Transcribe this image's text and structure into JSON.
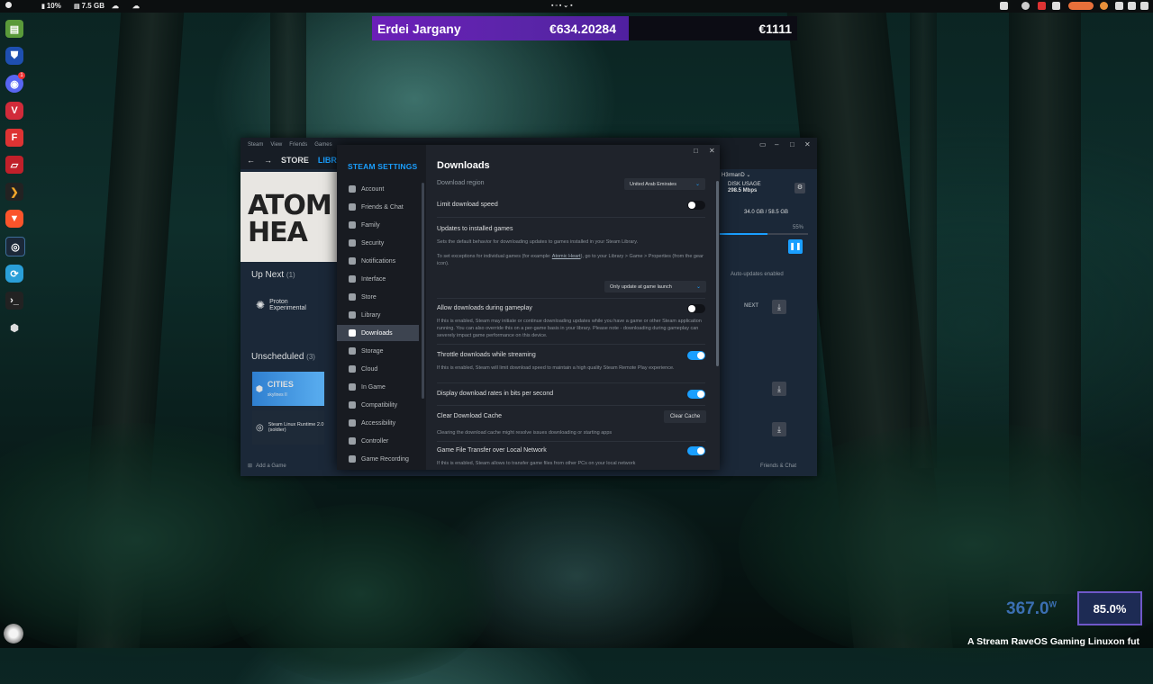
{
  "topbar": {
    "battery": "10%",
    "memory": "7.5 GB"
  },
  "banner": {
    "name": "Erdei Jargany",
    "amount": "€634.20284",
    "total": "€1111"
  },
  "dock": {
    "discord_badge": "1"
  },
  "library": {
    "menu": [
      "Steam",
      "View",
      "Friends",
      "Games"
    ],
    "nav": {
      "store": "STORE",
      "library": "LIBRARY"
    },
    "hero_lines": [
      "ATOM",
      "HEA"
    ],
    "up_next": {
      "title": "Up Next",
      "count": "(1)",
      "item": "Proton Experimental"
    },
    "unscheduled": {
      "title": "Unscheduled",
      "count": "(3)",
      "item1": "CITIES",
      "item1_sub": "skylines II",
      "item2": "Steam Linux Runtime 2.0 (soldier)"
    },
    "add_game": "Add a Game",
    "user": "H3rmanD",
    "disk_usage_label": "DISK USAGE",
    "disk_rate": "298.5 Mbps",
    "disk_size": "34.0 GB / 58.5 GB",
    "progress": "55%",
    "auto_updates": "Auto-updates enabled",
    "next": "NEXT",
    "friends_chat": "Friends & Chat"
  },
  "settings": {
    "title": "STEAM SETTINGS",
    "nav": [
      "Account",
      "Friends & Chat",
      "Family",
      "Security",
      "Notifications",
      "Interface",
      "Store",
      "Library",
      "Downloads",
      "Storage",
      "Cloud",
      "In Game",
      "Compatibility",
      "Accessibility",
      "Controller",
      "Game Recording"
    ],
    "heading": "Downloads",
    "download_region_label": "Download region",
    "download_region_value": "United Arab Emirates",
    "limit_speed": "Limit download speed",
    "updates_title": "Updates to installed games",
    "updates_desc": "Sets the default behavior for downloading updates to games installed in your Steam Library.",
    "updates_desc2_a": "To set exceptions for individual games (for example: ",
    "updates_desc2_link": "Atomic Heart",
    "updates_desc2_b": "), go to your Library > Game > Properties (from the gear icon).",
    "updates_value": "Only update at game launch",
    "allow_gameplay": "Allow downloads during gameplay",
    "allow_gameplay_desc": "If this is enabled, Steam may initiate or continue downloading updates while you have a game or other Steam application running. You can also override this on a per-game basis in your library. Please note - downloading during gameplay can severely impact game performance on this device.",
    "throttle": "Throttle downloads while streaming",
    "throttle_desc": "If this is enabled, Steam will limit download speed to maintain a high quality Steam Remote Play experience.",
    "bits": "Display download rates in bits per second",
    "clear_cache": "Clear Download Cache",
    "clear_cache_btn": "Clear Cache",
    "clear_cache_desc": "Clearing the download cache might resolve issues downloading or starting apps",
    "game_transfer": "Game File Transfer over Local Network",
    "game_transfer_desc": "If this is enabled, Steam allows to transfer game files from other PCs on your local network"
  },
  "overlay": {
    "watts": "367.0",
    "watts_unit": "W",
    "percent": "85.0%",
    "ticker": "A Stream RaveOS Gaming Linuxon fut"
  },
  "colors": {
    "accent": "#1a9fff",
    "banner_purple": "#6b1fb8",
    "steam_bg": "#1b2838"
  }
}
